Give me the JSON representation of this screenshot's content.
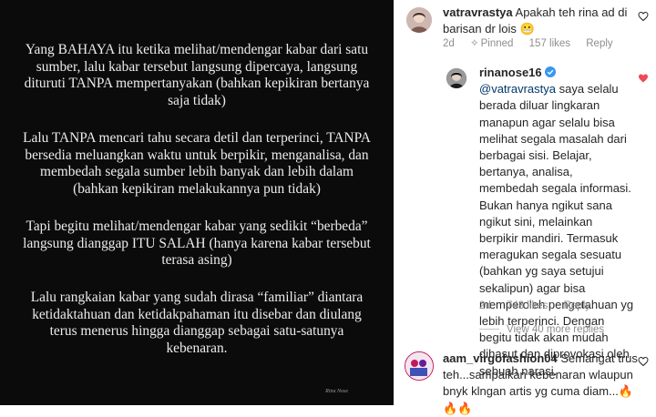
{
  "post": {
    "paragraphs": [
      "Yang BAHAYA itu ketika melihat/mendengar kabar dari satu sumber, lalu kabar tersebut langsung dipercaya, langsung dituruti TANPA mempertanyakan (bahkan kepikiran bertanya saja tidak)",
      "Lalu TANPA mencari tahu secara detil dan terperinci, TANPA bersedia meluangkan waktu untuk berpikir, menganalisa, dan membedah segala sumber lebih banyak dan lebih dalam (bahkan kepikiran melakukannya pun tidak)",
      "Tapi begitu melihat/mendengar kabar yang sedikit “berbeda” langsung dianggap ITU SALAH (hanya karena kabar tersebut terasa asing)",
      "Lalu rangkaian kabar yang sudah dirasa “familiar” diantara ketidaktahuan dan ketidakpahaman itu disebar dan diulang terus menerus hingga dianggap sebagai satu-satunya kebenaran."
    ],
    "credit": "Rina Nose"
  },
  "comments": [
    {
      "username": "vatravrastya",
      "text": "Apakah teh rina ad di barisan dr lois",
      "emoji": "😬",
      "age": "2d",
      "pinned": "Pinned",
      "likes": "157 likes",
      "reply": "Reply"
    },
    {
      "username": "rinanose16",
      "mention": "@vatravrastya",
      "text": "saya selalu berada diluar lingkaran manapun agar selalu bisa melihat segala masalah dari berbagai sisi. Belajar, bertanya, analisa, membedah segala informasi. Bukan hanya ngikut sana ngikut sini, melainkan berpikir mandiri. Termasuk meragukan segala sesuatu (bahkan yg saya setujui sekalipun) agar bisa memperoleh pengetahuan yg lebih terperinci. Dengan begitu tidak akan mudah dihasut dan diprovokasi oleh sebuah narasi.",
      "age": "2d",
      "likes": "743 likes",
      "reply": "Reply"
    },
    {
      "username": "aam_virgofashion04",
      "text": "Semangat trus teh...sampaikan kebenaran wlaupun bnyk klngan artis yg cuma diam...",
      "emoji": "🔥",
      "trailing_emoji": "🔥🔥"
    }
  ],
  "view_more": "View 40 more replies",
  "colors": {
    "post_bg": "#0b0b0b",
    "post_text": "#ececec",
    "mention": "#00376b",
    "meta": "#8e8e8e",
    "heart_liked": "#ed4956",
    "verified": "#3897f0"
  }
}
